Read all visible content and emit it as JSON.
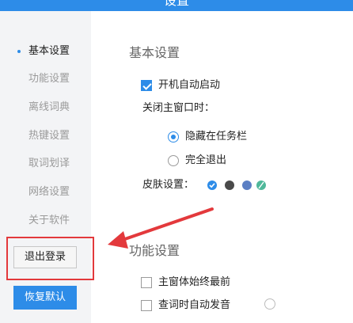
{
  "window": {
    "title": "设置"
  },
  "sidebar": {
    "items": [
      {
        "label": "基本设置",
        "active": true
      },
      {
        "label": "功能设置"
      },
      {
        "label": "离线词典"
      },
      {
        "label": "热键设置"
      },
      {
        "label": "取词划译"
      },
      {
        "label": "网络设置"
      },
      {
        "label": "关于软件"
      }
    ],
    "logout_label": "退出登录",
    "restore_label": "恢复默认"
  },
  "basic": {
    "title": "基本设置",
    "autostart_label": "开机自动启动",
    "autostart_checked": true,
    "close_label": "关闭主窗口时：",
    "hide_label": "隐藏在任务栏",
    "exit_label": "完全退出",
    "close_choice": "hide",
    "skin_label": "皮肤设置：",
    "skins": [
      "#2d8ce8",
      "#4a4a4a",
      "#5b7fc4",
      "#4fb89a"
    ]
  },
  "feature": {
    "title": "功能设置",
    "always_on_top_label": "主窗体始终最前",
    "auto_pronounce_label": "查词时自动发音"
  },
  "colors": {
    "accent": "#2d8ce8",
    "annotation": "#e3393c"
  }
}
